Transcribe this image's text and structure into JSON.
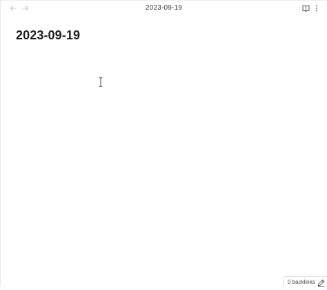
{
  "tab": {
    "title": "2023-09-19"
  },
  "nav": {
    "back_icon": "arrow-left-icon",
    "forward_icon": "arrow-right-icon"
  },
  "actions": {
    "reading_view_icon": "book-open-icon",
    "more_options_icon": "more-vertical-icon"
  },
  "note": {
    "title": "2023-09-19",
    "body": ""
  },
  "status": {
    "backlinks": "0 backlinks",
    "edit_icon": "pencil-icon"
  }
}
